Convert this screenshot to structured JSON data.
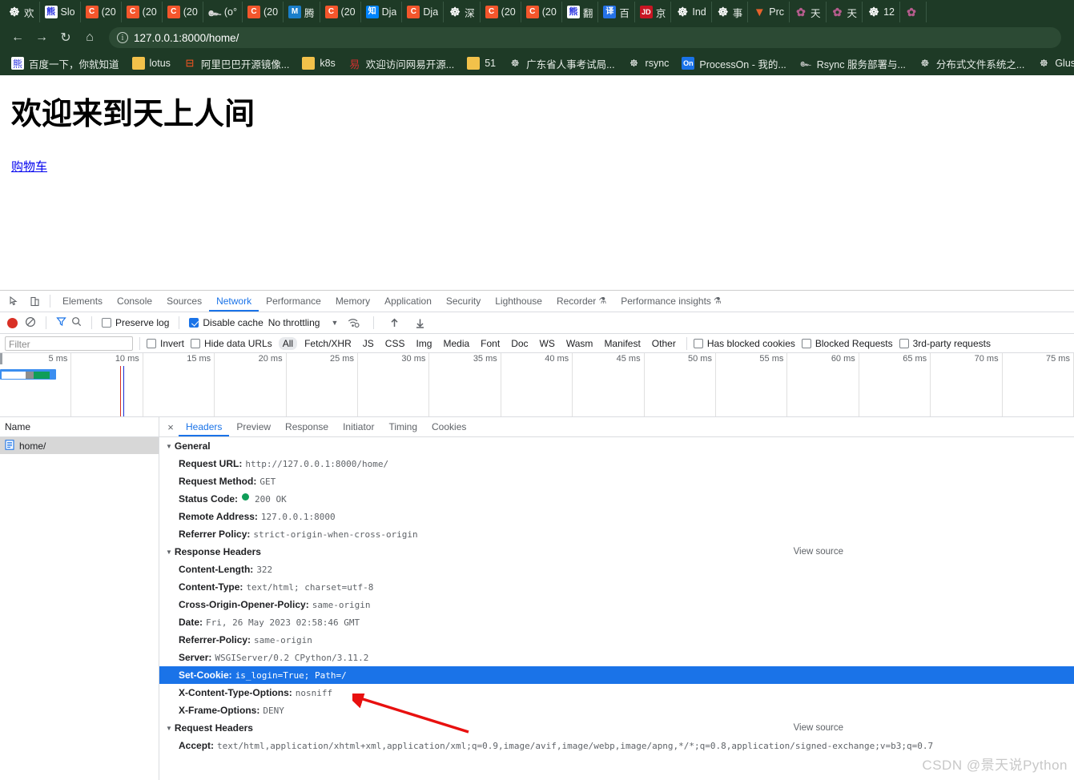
{
  "browser": {
    "tabs": [
      {
        "icon": "globe-icon",
        "icon_class": "fav-globe",
        "glyph": "☸",
        "label": "欢"
      },
      {
        "icon": "baidu-icon",
        "icon_class": "fav-baidu",
        "glyph": "熊",
        "label": "Slo"
      },
      {
        "icon": "csdn-icon",
        "icon_class": "fav-c",
        "glyph": "C",
        "label": "(20"
      },
      {
        "icon": "csdn-icon",
        "icon_class": "fav-c",
        "glyph": "C",
        "label": "(20"
      },
      {
        "icon": "csdn-icon",
        "icon_class": "fav-c",
        "glyph": "C",
        "label": "(20"
      },
      {
        "icon": "squiggle-icon",
        "icon_class": "fav-sq",
        "glyph": "๛",
        "label": "(o°"
      },
      {
        "icon": "csdn-icon",
        "icon_class": "fav-c",
        "glyph": "C",
        "label": "(20"
      },
      {
        "icon": "tencent-icon",
        "icon_class": "fav-m",
        "glyph": "M",
        "label": "腾"
      },
      {
        "icon": "csdn-icon",
        "icon_class": "fav-c",
        "glyph": "C",
        "label": "(20"
      },
      {
        "icon": "zhihu-icon",
        "icon_class": "fav-zhi",
        "glyph": "知",
        "label": "Dja"
      },
      {
        "icon": "csdn-icon",
        "icon_class": "fav-c",
        "glyph": "C",
        "label": "Dja"
      },
      {
        "icon": "globe-icon",
        "icon_class": "fav-globe",
        "glyph": "☸",
        "label": "深"
      },
      {
        "icon": "csdn-icon",
        "icon_class": "fav-c",
        "glyph": "C",
        "label": "(20"
      },
      {
        "icon": "csdn-icon",
        "icon_class": "fav-c",
        "glyph": "C",
        "label": "(20"
      },
      {
        "icon": "baidu-fanyi-icon",
        "icon_class": "fav-baidu",
        "glyph": "熊",
        "label": "翻"
      },
      {
        "icon": "youdao-icon",
        "icon_class": "fav-yi",
        "glyph": "译",
        "label": "百"
      },
      {
        "icon": "jd-icon",
        "icon_class": "fav-jd",
        "glyph": "JD",
        "label": "京"
      },
      {
        "icon": "globe-icon",
        "icon_class": "fav-globe",
        "glyph": "☸",
        "label": "Ind"
      },
      {
        "icon": "globe-icon",
        "icon_class": "fav-globe",
        "glyph": "☸",
        "label": "事"
      },
      {
        "icon": "gitlab-icon",
        "icon_class": "fav-fox",
        "glyph": "▼",
        "label": "Prc"
      },
      {
        "icon": "flower-icon",
        "icon_class": "fav-fl",
        "glyph": "✿",
        "label": "天"
      },
      {
        "icon": "flower-icon",
        "icon_class": "fav-fl",
        "glyph": "✿",
        "label": "天"
      },
      {
        "icon": "globe-icon",
        "icon_class": "fav-globe",
        "glyph": "☸",
        "label": "12"
      },
      {
        "icon": "flower-icon",
        "icon_class": "fav-fl",
        "glyph": "✿",
        "label": ""
      }
    ],
    "nav": {
      "back": "←",
      "forward": "→",
      "reload": "↻",
      "home": "⌂",
      "url": "127.0.0.1:8000/home/",
      "info_glyph": "i"
    },
    "bookmarks": [
      {
        "icon": "baidu-icon",
        "icon_class": "fav-baidu",
        "glyph": "熊",
        "label": "百度一下，你就知道"
      },
      {
        "icon": "folder-icon",
        "icon_class": "ico-folder",
        "glyph": "",
        "label": "lotus"
      },
      {
        "icon": "alibaba-icon",
        "icon_class": "ico-ali",
        "glyph": "⊟",
        "label": "阿里巴巴开源镜像..."
      },
      {
        "icon": "folder-icon",
        "icon_class": "ico-folder",
        "glyph": "",
        "label": "k8s"
      },
      {
        "icon": "netease-icon",
        "icon_class": "ico-net",
        "glyph": "易",
        "label": "欢迎访问网易开源..."
      },
      {
        "icon": "folder-icon",
        "icon_class": "ico-folder",
        "glyph": "",
        "label": "51"
      },
      {
        "icon": "globe-icon",
        "icon_class": "fav-globe",
        "glyph": "☸",
        "label": "广东省人事考试局..."
      },
      {
        "icon": "globe-icon",
        "icon_class": "fav-globe",
        "glyph": "☸",
        "label": "rsync"
      },
      {
        "icon": "processon-icon",
        "icon_class": "ico-on",
        "glyph": "On",
        "label": "ProcessOn - 我的..."
      },
      {
        "icon": "squiggle-icon",
        "icon_class": "fav-sq",
        "glyph": "๛",
        "label": "Rsync 服务部署与..."
      },
      {
        "icon": "globe-icon",
        "icon_class": "fav-globe",
        "glyph": "☸",
        "label": "分布式文件系统之..."
      },
      {
        "icon": "globe-icon",
        "icon_class": "fav-globe",
        "glyph": "☸",
        "label": "Glus"
      }
    ]
  },
  "page": {
    "heading": "欢迎来到天上人间",
    "link": "购物车"
  },
  "devtools": {
    "panel_tabs": [
      {
        "label": "Elements",
        "active": false,
        "beaker": false
      },
      {
        "label": "Console",
        "active": false,
        "beaker": false
      },
      {
        "label": "Sources",
        "active": false,
        "beaker": false
      },
      {
        "label": "Network",
        "active": true,
        "beaker": false
      },
      {
        "label": "Performance",
        "active": false,
        "beaker": false
      },
      {
        "label": "Memory",
        "active": false,
        "beaker": false
      },
      {
        "label": "Application",
        "active": false,
        "beaker": false
      },
      {
        "label": "Security",
        "active": false,
        "beaker": false
      },
      {
        "label": "Lighthouse",
        "active": false,
        "beaker": false
      },
      {
        "label": "Recorder",
        "active": false,
        "beaker": true
      },
      {
        "label": "Performance insights",
        "active": false,
        "beaker": true
      }
    ],
    "toolbar": {
      "record_title": "record-button",
      "clear_title": "clear-button",
      "filter_title": "filter-button",
      "search_title": "search-button",
      "preserve_log_label": "Preserve log",
      "preserve_log_checked": false,
      "disable_cache_label": "Disable cache",
      "disable_cache_checked": true,
      "throttling_value": "No throttling",
      "import_title": "import-har",
      "export_title": "export-har"
    },
    "filterbar": {
      "filter_placeholder": "Filter",
      "filter_value": "",
      "invert_label": "Invert",
      "invert_checked": false,
      "hide_data_urls_label": "Hide data URLs",
      "hide_data_urls_checked": false,
      "types": [
        "All",
        "Fetch/XHR",
        "JS",
        "CSS",
        "Img",
        "Media",
        "Font",
        "Doc",
        "WS",
        "Wasm",
        "Manifest",
        "Other"
      ],
      "selected_type": "All",
      "has_blocked_cookies_label": "Has blocked cookies",
      "has_blocked_cookies_checked": false,
      "blocked_requests_label": "Blocked Requests",
      "blocked_requests_checked": false,
      "third_party_label": "3rd-party requests",
      "third_party_checked": false
    },
    "overview": {
      "ticks": [
        "5 ms",
        "10 ms",
        "15 ms",
        "20 ms",
        "25 ms",
        "30 ms",
        "35 ms",
        "40 ms",
        "45 ms",
        "50 ms",
        "55 ms",
        "60 ms",
        "65 ms",
        "70 ms",
        "75 ms"
      ]
    },
    "request_list": {
      "column_header": "Name",
      "rows": [
        {
          "name": "home/",
          "icon": "document-icon",
          "selected": true
        }
      ]
    },
    "detail_tabs": [
      {
        "label": "Headers",
        "active": true
      },
      {
        "label": "Preview",
        "active": false
      },
      {
        "label": "Response",
        "active": false
      },
      {
        "label": "Initiator",
        "active": false
      },
      {
        "label": "Timing",
        "active": false
      },
      {
        "label": "Cookies",
        "active": false
      }
    ],
    "sections": [
      {
        "title": "General",
        "view_source": null,
        "rows": [
          {
            "key": "Request URL:",
            "value": "http://127.0.0.1:8000/home/",
            "selected": false,
            "status_dot": false
          },
          {
            "key": "Request Method:",
            "value": "GET",
            "selected": false,
            "status_dot": false
          },
          {
            "key": "Status Code:",
            "value": "200 OK",
            "selected": false,
            "status_dot": true
          },
          {
            "key": "Remote Address:",
            "value": "127.0.0.1:8000",
            "selected": false,
            "status_dot": false
          },
          {
            "key": "Referrer Policy:",
            "value": "strict-origin-when-cross-origin",
            "selected": false,
            "status_dot": false
          }
        ]
      },
      {
        "title": "Response Headers",
        "view_source": "View source",
        "rows": [
          {
            "key": "Content-Length:",
            "value": "322",
            "selected": false,
            "status_dot": false
          },
          {
            "key": "Content-Type:",
            "value": "text/html; charset=utf-8",
            "selected": false,
            "status_dot": false
          },
          {
            "key": "Cross-Origin-Opener-Policy:",
            "value": "same-origin",
            "selected": false,
            "status_dot": false
          },
          {
            "key": "Date:",
            "value": "Fri, 26 May 2023 02:58:46 GMT",
            "selected": false,
            "status_dot": false
          },
          {
            "key": "Referrer-Policy:",
            "value": "same-origin",
            "selected": false,
            "status_dot": false
          },
          {
            "key": "Server:",
            "value": "WSGIServer/0.2 CPython/3.11.2",
            "selected": false,
            "status_dot": false
          },
          {
            "key": "Set-Cookie:",
            "value": "is_login=True; Path=/",
            "selected": true,
            "status_dot": false
          },
          {
            "key": "X-Content-Type-Options:",
            "value": "nosniff",
            "selected": false,
            "status_dot": false
          },
          {
            "key": "X-Frame-Options:",
            "value": "DENY",
            "selected": false,
            "status_dot": false
          }
        ]
      },
      {
        "title": "Request Headers",
        "view_source": "View source",
        "rows": [
          {
            "key": "Accept:",
            "value": "text/html,application/xhtml+xml,application/xml;q=0.9,image/avif,image/webp,image/apng,*/*;q=0.8,application/signed-exchange;v=b3;q=0.7",
            "selected": false,
            "status_dot": false
          }
        ]
      }
    ]
  },
  "watermark": "CSDN @景天说Python",
  "colors": {
    "chrome_bg": "#1e3a26",
    "accent_blue": "#1a73e8",
    "status_green": "#0f9d58",
    "record_red": "#d93025",
    "arrow_red": "#e8100f",
    "link_blue": "#0000ee"
  }
}
